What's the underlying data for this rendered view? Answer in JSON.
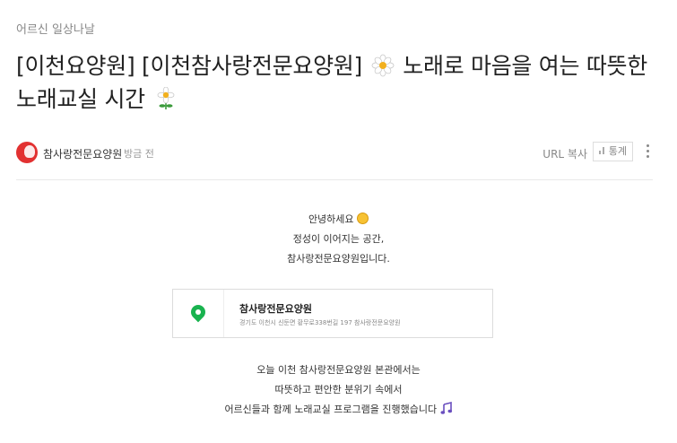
{
  "category": "어르신 일상나날",
  "title": {
    "part1": "[이천요양원] [이천참사랑전문요양원]",
    "part2": "노래로 마음을 여는 따뜻한",
    "part3": "노래교실 시간"
  },
  "author": {
    "name": "참사랑전문요양원",
    "time": "방금 전"
  },
  "actions": {
    "url_copy": "URL 복사",
    "stats": "통계"
  },
  "intro": {
    "line1": "안녕하세요",
    "line2": "정성이 이어지는 공간,",
    "line3": "참사랑전문요양원입니다."
  },
  "place": {
    "name": "참사랑전문요양원",
    "address": "경기도 이천시 신둔면 황무로338번길 197 참사랑전문요양원"
  },
  "body": {
    "line1": "오늘 이천 참사랑전문요양원 본관에서는",
    "line2": "따뜻하고 편안한 분위기 속에서",
    "line3": "어르신들과 함께 노래교실 프로그램을 진행했습니다"
  },
  "colors": {
    "pin": "#19b34f",
    "avatar": "#e23131"
  }
}
